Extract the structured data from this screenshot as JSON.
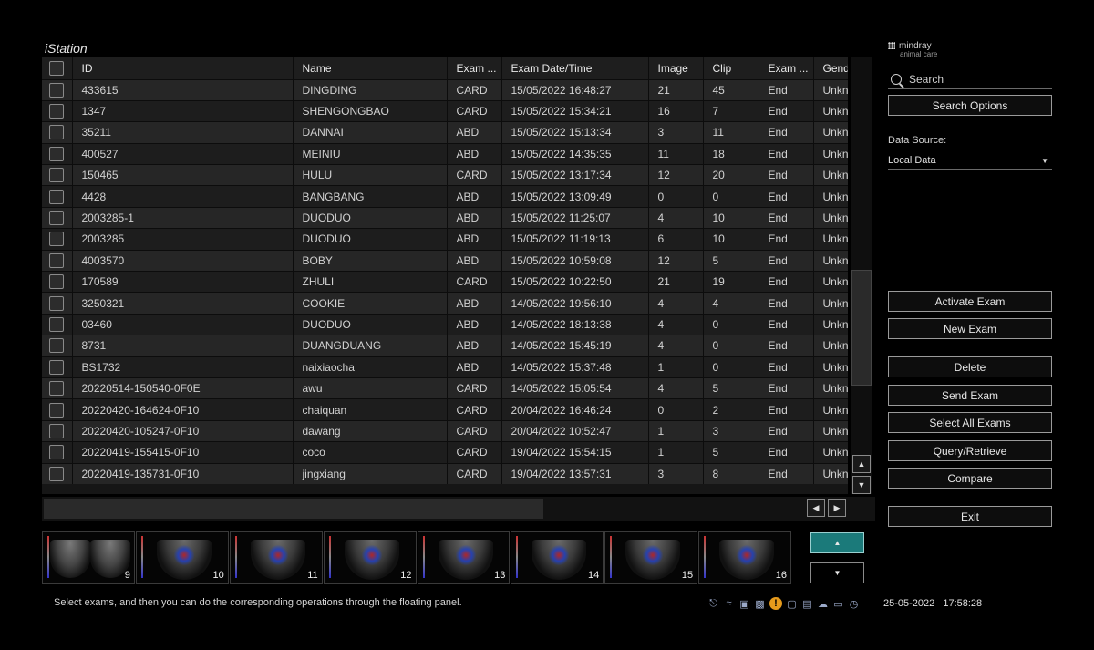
{
  "app": {
    "title": "iStation"
  },
  "brand": {
    "name": "mindray",
    "sub": "animal care"
  },
  "table": {
    "columns": [
      "ID",
      "Name",
      "Exam ...",
      "Exam Date/Time",
      "Image",
      "Clip",
      "Exam ...",
      "Gend"
    ],
    "rows": [
      [
        "433615",
        "DINGDING",
        "CARD",
        "15/05/2022 16:48:27",
        "21",
        "45",
        "End",
        "Unkn"
      ],
      [
        "1347",
        "SHENGONGBAO",
        "CARD",
        "15/05/2022 15:34:21",
        "16",
        "7",
        "End",
        "Unkn"
      ],
      [
        "35211",
        "DANNAI",
        "ABD",
        "15/05/2022 15:13:34",
        "3",
        "11",
        "End",
        "Unkn"
      ],
      [
        "400527",
        "MEINIU",
        "ABD",
        "15/05/2022 14:35:35",
        "11",
        "18",
        "End",
        "Unkn"
      ],
      [
        "150465",
        "HULU",
        "CARD",
        "15/05/2022 13:17:34",
        "12",
        "20",
        "End",
        "Unkn"
      ],
      [
        "4428",
        "BANGBANG",
        "ABD",
        "15/05/2022 13:09:49",
        "0",
        "0",
        "End",
        "Unkn"
      ],
      [
        "2003285-1",
        "DUODUO",
        "ABD",
        "15/05/2022 11:25:07",
        "4",
        "10",
        "End",
        "Unkn"
      ],
      [
        "2003285",
        "DUODUO",
        "ABD",
        "15/05/2022 11:19:13",
        "6",
        "10",
        "End",
        "Unkn"
      ],
      [
        "4003570",
        "BOBY",
        "ABD",
        "15/05/2022 10:59:08",
        "12",
        "5",
        "End",
        "Unkn"
      ],
      [
        "170589",
        "ZHULI",
        "CARD",
        "15/05/2022 10:22:50",
        "21",
        "19",
        "End",
        "Unkn"
      ],
      [
        "3250321",
        "COOKIE",
        "ABD",
        "14/05/2022 19:56:10",
        "4",
        "4",
        "End",
        "Unkn"
      ],
      [
        "03460",
        "DUODUO",
        "ABD",
        "14/05/2022 18:13:38",
        "4",
        "0",
        "End",
        "Unkn"
      ],
      [
        "8731",
        "DUANGDUANG",
        "ABD",
        "14/05/2022 15:45:19",
        "4",
        "0",
        "End",
        "Unkn"
      ],
      [
        "BS1732",
        "naixiaocha",
        "ABD",
        "14/05/2022 15:37:48",
        "1",
        "0",
        "End",
        "Unkn"
      ],
      [
        "20220514-150540-0F0E",
        "awu",
        "CARD",
        "14/05/2022 15:05:54",
        "4",
        "5",
        "End",
        "Unkn"
      ],
      [
        "20220420-164624-0F10",
        "chaiquan",
        "CARD",
        "20/04/2022 16:46:24",
        "0",
        "2",
        "End",
        "Unkn"
      ],
      [
        "20220420-105247-0F10",
        "dawang",
        "CARD",
        "20/04/2022 10:52:47",
        "1",
        "3",
        "End",
        "Unkn"
      ],
      [
        "20220419-155415-0F10",
        "coco",
        "CARD",
        "19/04/2022 15:54:15",
        "1",
        "5",
        "End",
        "Unkn"
      ],
      [
        "20220419-135731-0F10",
        "jingxiang",
        "CARD",
        "19/04/2022 13:57:31",
        "3",
        "8",
        "End",
        "Unkn"
      ]
    ]
  },
  "panel": {
    "search_placeholder": "Search",
    "search_options": "Search Options",
    "data_source_label": "Data Source:",
    "data_source_value": "Local Data",
    "activate_exam": "Activate Exam",
    "new_exam": "New Exam",
    "delete": "Delete",
    "send_exam": "Send Exam",
    "select_all": "Select All Exams",
    "query_retrieve": "Query/Retrieve",
    "compare": "Compare",
    "exit": "Exit"
  },
  "thumbnails": [
    "9",
    "10",
    "11",
    "12",
    "13",
    "14",
    "15",
    "16"
  ],
  "scroll_glyphs": {
    "up": "▲",
    "down": "▼",
    "left": "◀",
    "right": "▶"
  },
  "status": {
    "message": "Select exams, and then you can do the corresponding operations through the floating panel.",
    "warning_glyph": "!",
    "date": "25-05-2022",
    "time": "17:58:28"
  },
  "colors": {
    "background": "#000000",
    "row_even": "#262626",
    "row_odd": "#1d1d1d",
    "thumb_nav_accent": "#1b7a7a",
    "warning": "#e59a1c"
  }
}
